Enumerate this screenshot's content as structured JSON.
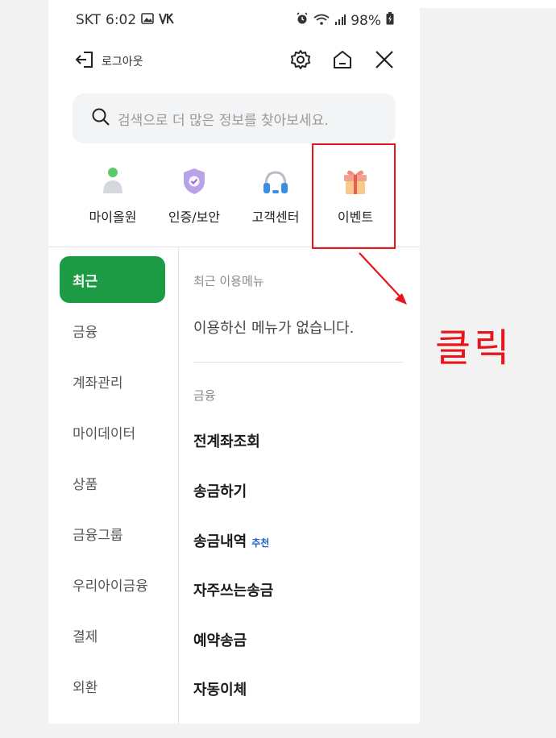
{
  "status_bar": {
    "carrier": "SKT",
    "time": "6:02",
    "battery": "98%"
  },
  "header": {
    "logout_label": "로그아웃",
    "icons": [
      "settings-icon",
      "home-icon",
      "close-icon"
    ]
  },
  "search": {
    "placeholder": "검색으로 더 많은 정보를 찾아보세요."
  },
  "quick_menu": [
    {
      "label": "마이올원",
      "icon": "person-icon"
    },
    {
      "label": "인증/보안",
      "icon": "shield-icon"
    },
    {
      "label": "고객센터",
      "icon": "headset-icon"
    },
    {
      "label": "이벤트",
      "icon": "gift-icon"
    }
  ],
  "nav": {
    "items": [
      "최근",
      "금융",
      "계좌관리",
      "마이데이터",
      "상품",
      "금융그룹",
      "우리아이금융",
      "결제",
      "외환"
    ],
    "active_index": 0
  },
  "content": {
    "recent_title": "최근 이용메뉴",
    "recent_empty": "이용하신 메뉴가 없습니다.",
    "finance_title": "금융",
    "finance_items": [
      {
        "label": "전계좌조회",
        "badge": ""
      },
      {
        "label": "송금하기",
        "badge": ""
      },
      {
        "label": "송금내역",
        "badge": "추천"
      },
      {
        "label": "자주쓰는송금",
        "badge": ""
      },
      {
        "label": "예약송금",
        "badge": ""
      },
      {
        "label": "자동이체",
        "badge": ""
      }
    ]
  },
  "annotation": {
    "label": "클릭",
    "color": "#e8141b"
  },
  "colors": {
    "accent_green": "#1d9a44",
    "badge_blue": "#1c66c4"
  }
}
